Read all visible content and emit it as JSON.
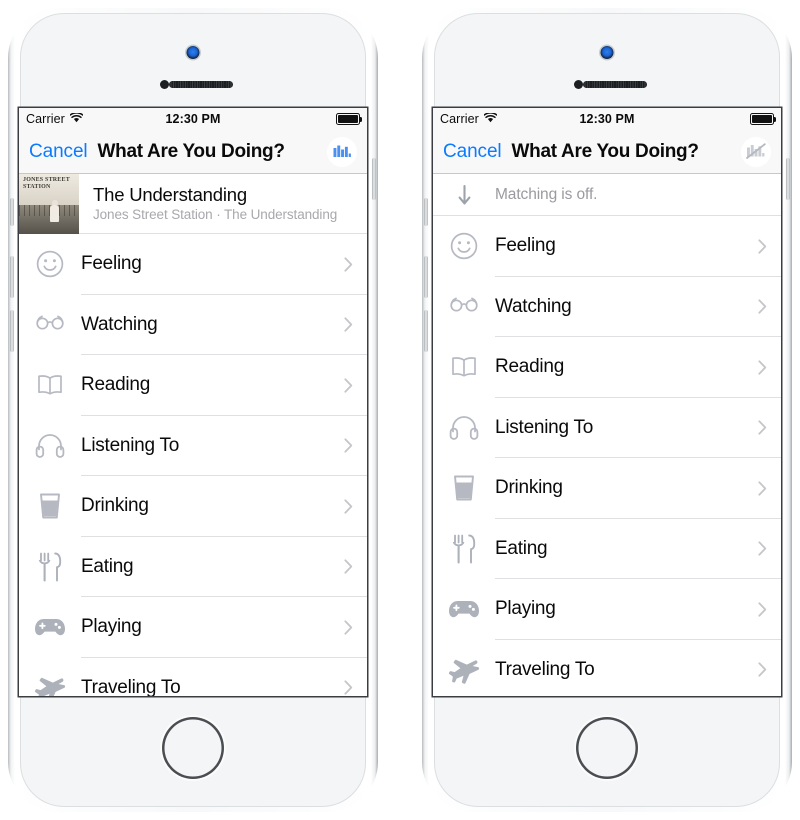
{
  "colors": {
    "accent_blue": "#0b7bff",
    "chart_icon_blue": "#4a90f0",
    "icon_grey": "#adb1ba",
    "separator": "#e0e0e2",
    "navbar_bg": "#f8f8f8",
    "subtitle_grey": "#a8a8ad",
    "matching_text_grey": "#9a9aa0"
  },
  "status_bar": {
    "carrier": "Carrier",
    "wifi_icon": "wifi-icon",
    "time": "12:30 PM",
    "battery_icon": "battery-full-icon"
  },
  "navbar": {
    "cancel_label": "Cancel",
    "title": "What Are You Doing?",
    "action_icon_enabled": "bar-chart-icon",
    "action_icon_disabled": "bar-chart-slash-icon"
  },
  "now_playing": {
    "artwork_label": "JONES STREET STATION",
    "title": "The Understanding",
    "subtitle": "Jones Street Station · The Understanding"
  },
  "matching": {
    "icon": "arrow-down-icon",
    "text": "Matching is off."
  },
  "rows": [
    {
      "icon": "smiley-face-icon",
      "label": "Feeling",
      "chevron": "chevron-right-icon"
    },
    {
      "icon": "glasses-icon",
      "label": "Watching",
      "chevron": "chevron-right-icon"
    },
    {
      "icon": "open-book-icon",
      "label": "Reading",
      "chevron": "chevron-right-icon"
    },
    {
      "icon": "headphones-icon",
      "label": "Listening To",
      "chevron": "chevron-right-icon"
    },
    {
      "icon": "drink-glass-icon",
      "label": "Drinking",
      "chevron": "chevron-right-icon"
    },
    {
      "icon": "fork-knife-icon",
      "label": "Eating",
      "chevron": "chevron-right-icon"
    },
    {
      "icon": "gamepad-icon",
      "label": "Playing",
      "chevron": "chevron-right-icon"
    },
    {
      "icon": "airplane-icon",
      "label": "Traveling To",
      "chevron": "chevron-right-icon"
    }
  ]
}
